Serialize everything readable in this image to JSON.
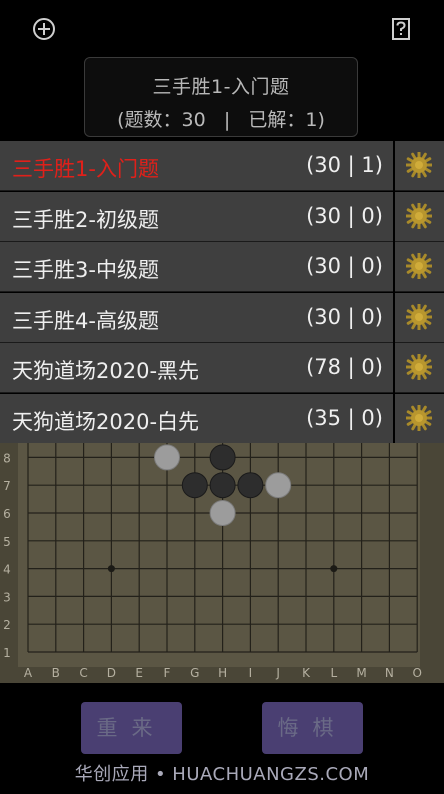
{
  "toolbar": {
    "add_icon": "plus-circle-icon",
    "help_icon": "question-box-icon"
  },
  "summary": {
    "title": "三手胜1-入门题",
    "stats": "(题数：30   |   已解：1)"
  },
  "problem_sets": [
    {
      "name": "三手胜1-入门题",
      "count": "(30 | 1)",
      "active": true
    },
    {
      "name": "三手胜2-初级题",
      "count": "(30 | 0)",
      "active": false
    },
    {
      "name": "三手胜3-中级题",
      "count": "(30 | 0)",
      "active": false
    },
    {
      "name": "三手胜4-高级题",
      "count": "(30 | 0)",
      "active": false
    },
    {
      "name": "天狗道场2020-黑先",
      "count": "(78 | 0)",
      "active": false
    },
    {
      "name": "天狗道场2020-白先",
      "count": "(35 | 0)",
      "active": false
    }
  ],
  "board": {
    "columns": [
      "A",
      "B",
      "C",
      "D",
      "E",
      "F",
      "G",
      "H",
      "I",
      "J",
      "K",
      "L",
      "M",
      "N",
      "O"
    ],
    "rows": [
      "1",
      "2",
      "3",
      "4",
      "5",
      "6",
      "7",
      "8"
    ],
    "star_points": [
      [
        "D",
        "4"
      ],
      [
        "L",
        "4"
      ]
    ],
    "stones": [
      {
        "col": "F",
        "row": "8",
        "color": "white"
      },
      {
        "col": "H",
        "row": "8",
        "color": "black"
      },
      {
        "col": "G",
        "row": "7",
        "color": "black"
      },
      {
        "col": "H",
        "row": "7",
        "color": "black"
      },
      {
        "col": "I",
        "row": "7",
        "color": "black"
      },
      {
        "col": "J",
        "row": "7",
        "color": "white"
      },
      {
        "col": "H",
        "row": "6",
        "color": "white"
      }
    ]
  },
  "buttons": {
    "restart": "重来",
    "undo": "悔棋"
  },
  "watermark": "华创应用 • HUACHUANGZS.COM",
  "colors": {
    "active_item": "#e0201a",
    "list_bg": "#3f3f3f",
    "button_bg": "#4a3f72",
    "board_bg": "#4a4637"
  }
}
